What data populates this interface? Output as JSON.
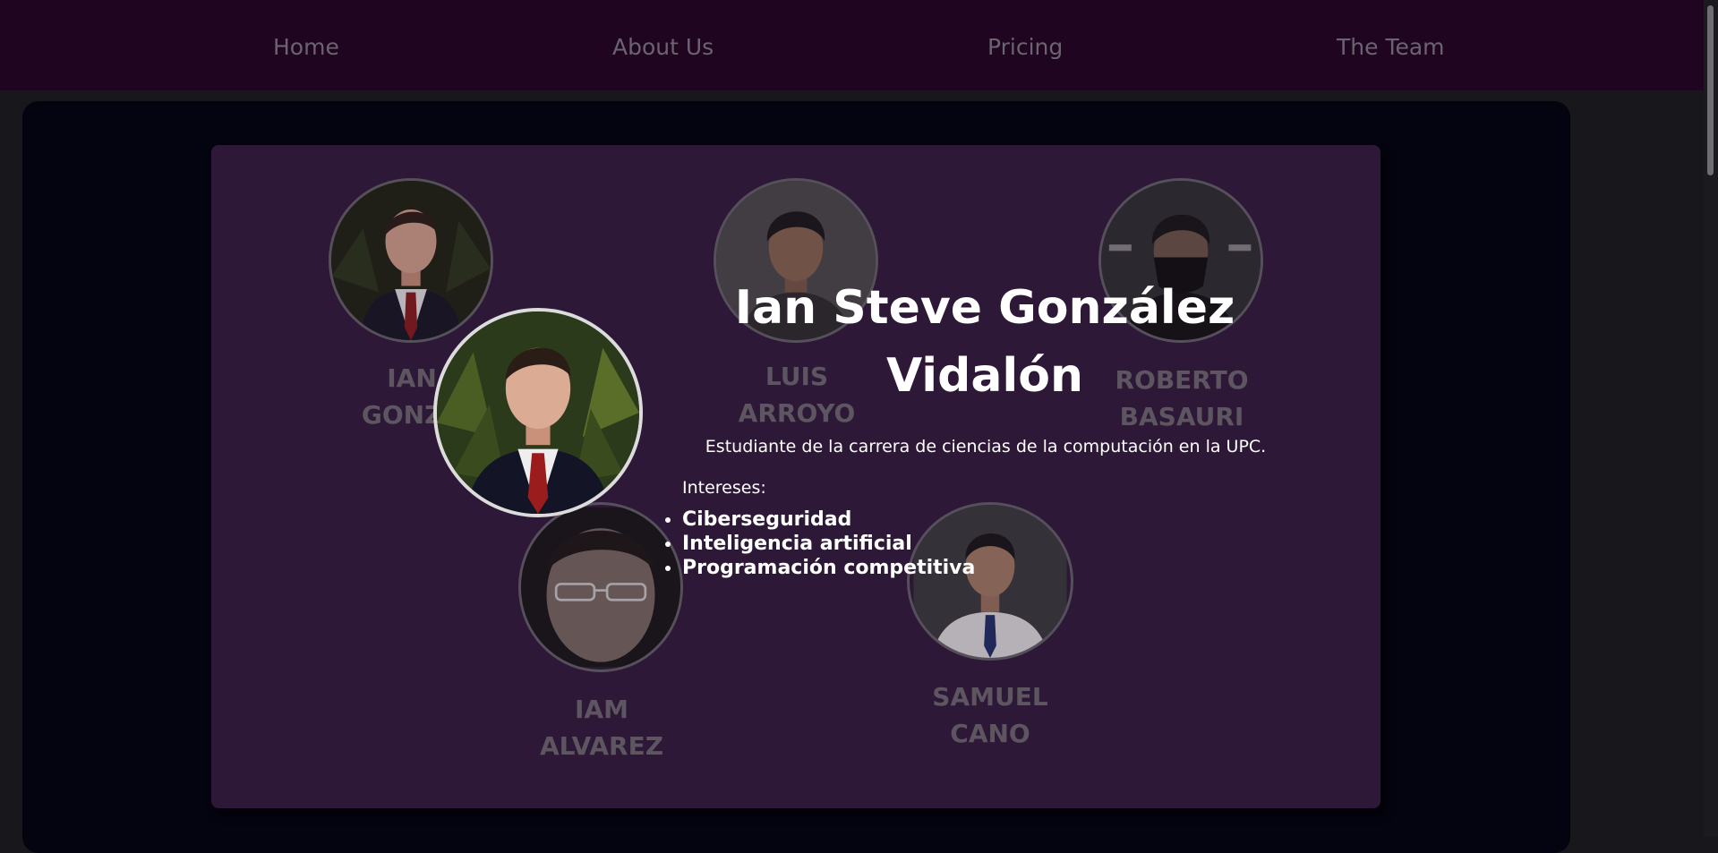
{
  "nav": {
    "items": [
      {
        "label": "Home"
      },
      {
        "label": "About Us"
      },
      {
        "label": "Pricing"
      },
      {
        "label": "The Team"
      }
    ]
  },
  "team": {
    "members": [
      {
        "first": "IAN",
        "last": "GONZÁ"
      },
      {
        "first": "LUIS",
        "last": "ARROYO"
      },
      {
        "first": "ROBERTO",
        "last": "BASAURI"
      },
      {
        "first": "IAM",
        "last": "ALVAREZ"
      },
      {
        "first": "SAMUEL",
        "last": "CANO"
      }
    ]
  },
  "detail": {
    "name_line1": "Ian Steve González",
    "name_line2": "Vidalón",
    "description": "Estudiante de la carrera de ciencias de la computación en la UPC.",
    "interests_label": "Intereses:",
    "interests": [
      "Ciberseguridad",
      "Inteligencia artificial",
      "Programación competitiva"
    ]
  },
  "colors": {
    "navbar_bg": "#1f0520",
    "card_bg": "#2e1837",
    "panel_bg": "#040310",
    "page_bg": "#18171c",
    "muted_text": "#5d5560",
    "text": "#ffffff"
  }
}
